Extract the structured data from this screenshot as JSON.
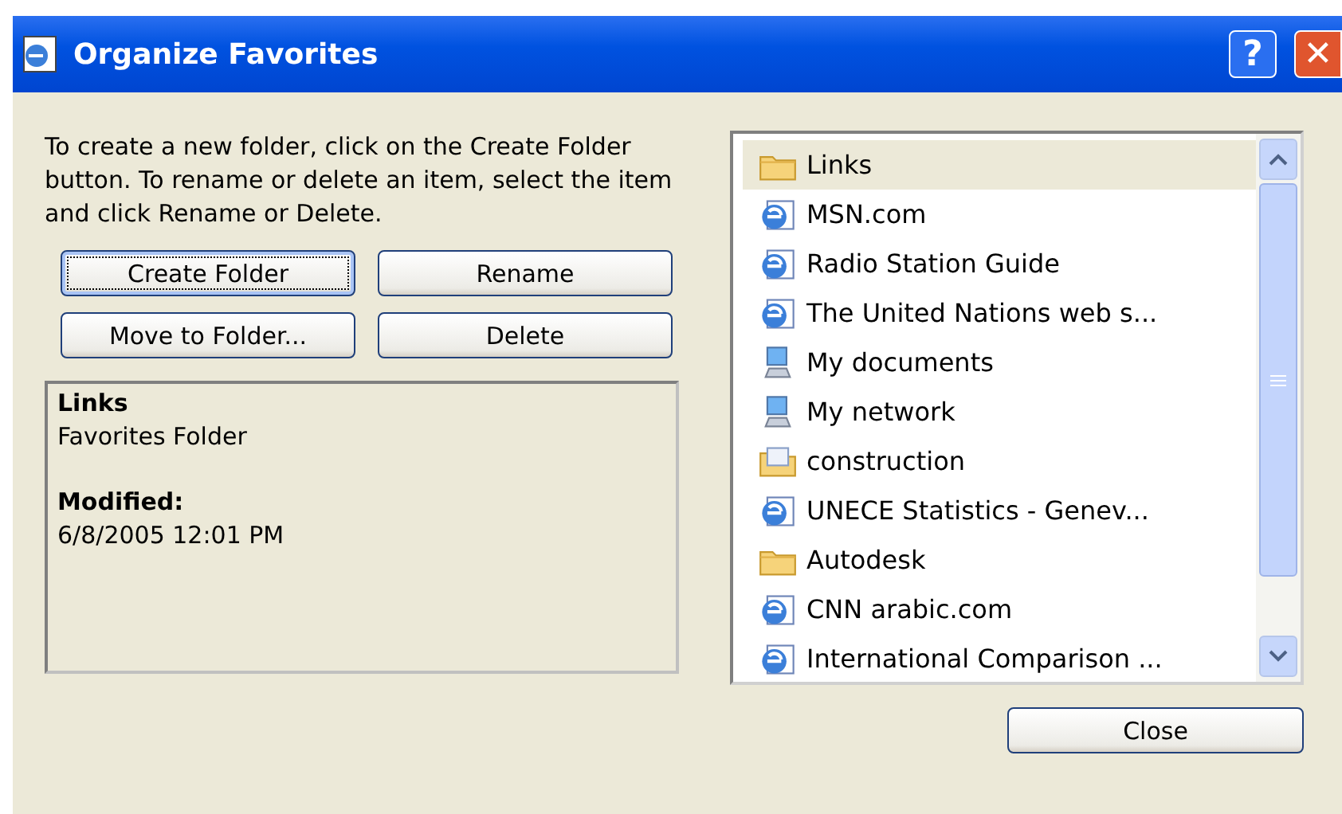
{
  "window": {
    "title": "Organize Favorites",
    "help_button": "?",
    "close_button": "✕"
  },
  "instructions": "To create a new folder, click on the Create Folder button. To rename or delete an item, select the item and click Rename or Delete.",
  "buttons": [
    {
      "label": "Create Folder",
      "focused": true
    },
    {
      "label": "Rename",
      "focused": false
    },
    {
      "label": "Move to Folder...",
      "focused": false
    },
    {
      "label": "Delete",
      "focused": false
    }
  ],
  "details": {
    "name": "Links",
    "type": "Favorites Folder",
    "modified_label": "Modified:",
    "modified_value": "6/8/2005 12:01 PM"
  },
  "favorites": [
    {
      "label": "Links",
      "kind": "folder",
      "selected": true
    },
    {
      "label": "MSN.com",
      "kind": "web",
      "selected": false
    },
    {
      "label": "Radio Station Guide",
      "kind": "web",
      "selected": false
    },
    {
      "label": "The United Nations web s...",
      "kind": "web",
      "selected": false
    },
    {
      "label": "My documents",
      "kind": "computer",
      "selected": false
    },
    {
      "label": "My network",
      "kind": "computer",
      "selected": false
    },
    {
      "label": "construction",
      "kind": "offline",
      "selected": false
    },
    {
      "label": "UNECE Statistics - Genev...",
      "kind": "web",
      "selected": false
    },
    {
      "label": "Autodesk",
      "kind": "folder",
      "selected": false
    },
    {
      "label": "CNN arabic.com",
      "kind": "web",
      "selected": false
    },
    {
      "label": "International Comparison ...",
      "kind": "web",
      "selected": false
    }
  ],
  "close": "Close"
}
